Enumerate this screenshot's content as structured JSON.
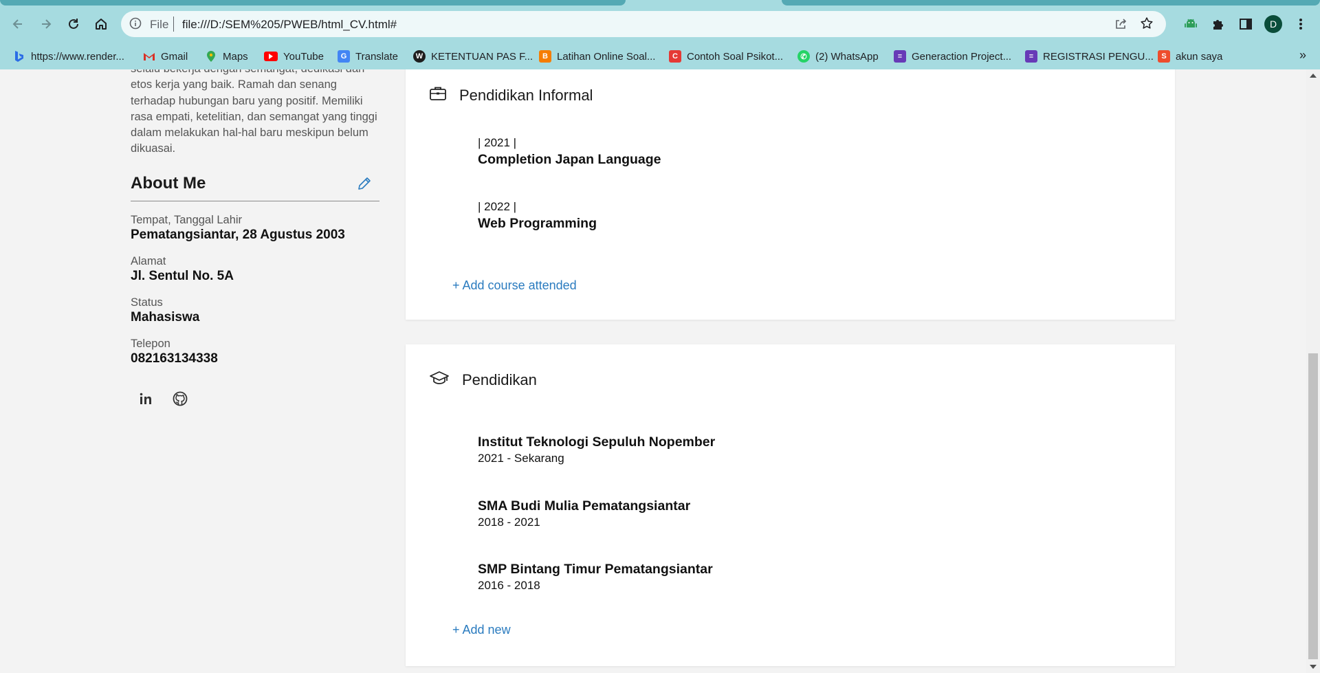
{
  "browser": {
    "url_scheme_label": "File",
    "url": "file:///D:/SEM%205/PWEB/html_CV.html#",
    "profile_initial": "D",
    "bookmarks": [
      {
        "label": "https://www.render...",
        "icon": "bing-icon",
        "color": "#2b6de6"
      },
      {
        "label": "Gmail",
        "icon": "gmail-icon",
        "color": "#d93025"
      },
      {
        "label": "Maps",
        "icon": "maps-icon",
        "color": "#34a853"
      },
      {
        "label": "YouTube",
        "icon": "youtube-icon",
        "color": "#ff0000"
      },
      {
        "label": "Translate",
        "icon": "translate-icon",
        "color": "#4285f4"
      },
      {
        "label": "KETENTUAN PAS F...",
        "icon": "wordpress-icon",
        "color": "#1e1e1e"
      },
      {
        "label": "Latihan Online Soal...",
        "icon": "blogger-icon",
        "color": "#f57d00"
      },
      {
        "label": "Contoh Soal Psikot...",
        "icon": "site-icon",
        "color": "#e53935"
      },
      {
        "label": "(2) WhatsApp",
        "icon": "whatsapp-icon",
        "color": "#25d366"
      },
      {
        "label": "Generaction Project...",
        "icon": "forms-icon",
        "color": "#673ab7"
      },
      {
        "label": "REGISTRASI PENGU...",
        "icon": "forms-icon",
        "color": "#673ab7"
      },
      {
        "label": "akun saya",
        "icon": "shopee-icon",
        "color": "#ee4d2d"
      }
    ],
    "more_bookmarks": "»"
  },
  "sidebar": {
    "summary": "selalu bekerja dengan semangat, dedikasi dan etos kerja yang baik. Ramah dan senang terhadap hubungan baru yang positif. Memiliki rasa empati, ketelitian, dan semangat yang tinggi dalam melakukan hal-hal baru meskipun belum dikuasai.",
    "about_title": "About Me",
    "fields": [
      {
        "label": "Tempat, Tanggal Lahir",
        "value": "Pematangsiantar, 28 Agustus 2003"
      },
      {
        "label": "Alamat",
        "value": "Jl. Sentul No. 5A"
      },
      {
        "label": "Status",
        "value": "Mahasiswa"
      },
      {
        "label": "Telepon",
        "value": "082163134338"
      }
    ]
  },
  "informal": {
    "title": "Pendidikan Informal",
    "entries": [
      {
        "year": "| 2021 |",
        "name": "Completion Japan Language"
      },
      {
        "year": "| 2022 |",
        "name": "Web Programming"
      }
    ],
    "add_label": "+ Add course attended"
  },
  "education": {
    "title": "Pendidikan",
    "entries": [
      {
        "name": "Institut Teknologi Sepuluh Nopember",
        "period": "2021 - Sekarang"
      },
      {
        "name": "SMA Budi Mulia Pematangsiantar",
        "period": "2018 - 2021"
      },
      {
        "name": "SMP Bintang Timur Pematangsiantar",
        "period": "2016 - 2018"
      }
    ],
    "add_label": "+ Add new"
  },
  "colors": {
    "accent_link": "#2a7bbf",
    "chrome_bg": "#a6dbe0"
  }
}
